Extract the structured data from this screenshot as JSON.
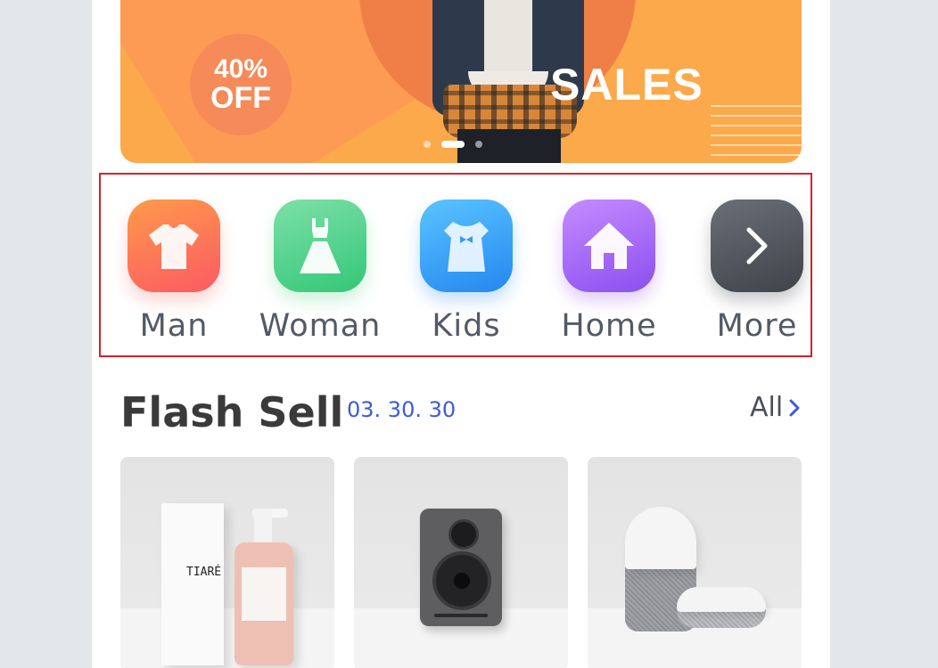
{
  "banner": {
    "discount_line1": "40%",
    "discount_line2": "OFF",
    "headline": "SALES",
    "slides": 3,
    "active_slide": 2
  },
  "categories": [
    {
      "label": "Man",
      "icon": "tshirt-icon"
    },
    {
      "label": "Woman",
      "icon": "dress-icon"
    },
    {
      "label": "Kids",
      "icon": "kids-dress-icon"
    },
    {
      "label": "Home",
      "icon": "house-icon"
    },
    {
      "label": "More",
      "icon": "chevron-right-icon"
    }
  ],
  "flash": {
    "title": "Flash Sell",
    "timer": "03. 30. 30",
    "all_label": "All"
  },
  "products": [
    {
      "name": "soap-bottle-product",
      "box_text": "TIARÉ"
    },
    {
      "name": "speaker-product"
    },
    {
      "name": "smart-speaker-product"
    }
  ],
  "colors": {
    "accent_blue": "#3b5bdb",
    "banner_orange": "#fba94a",
    "highlight_red": "#d2232a"
  }
}
